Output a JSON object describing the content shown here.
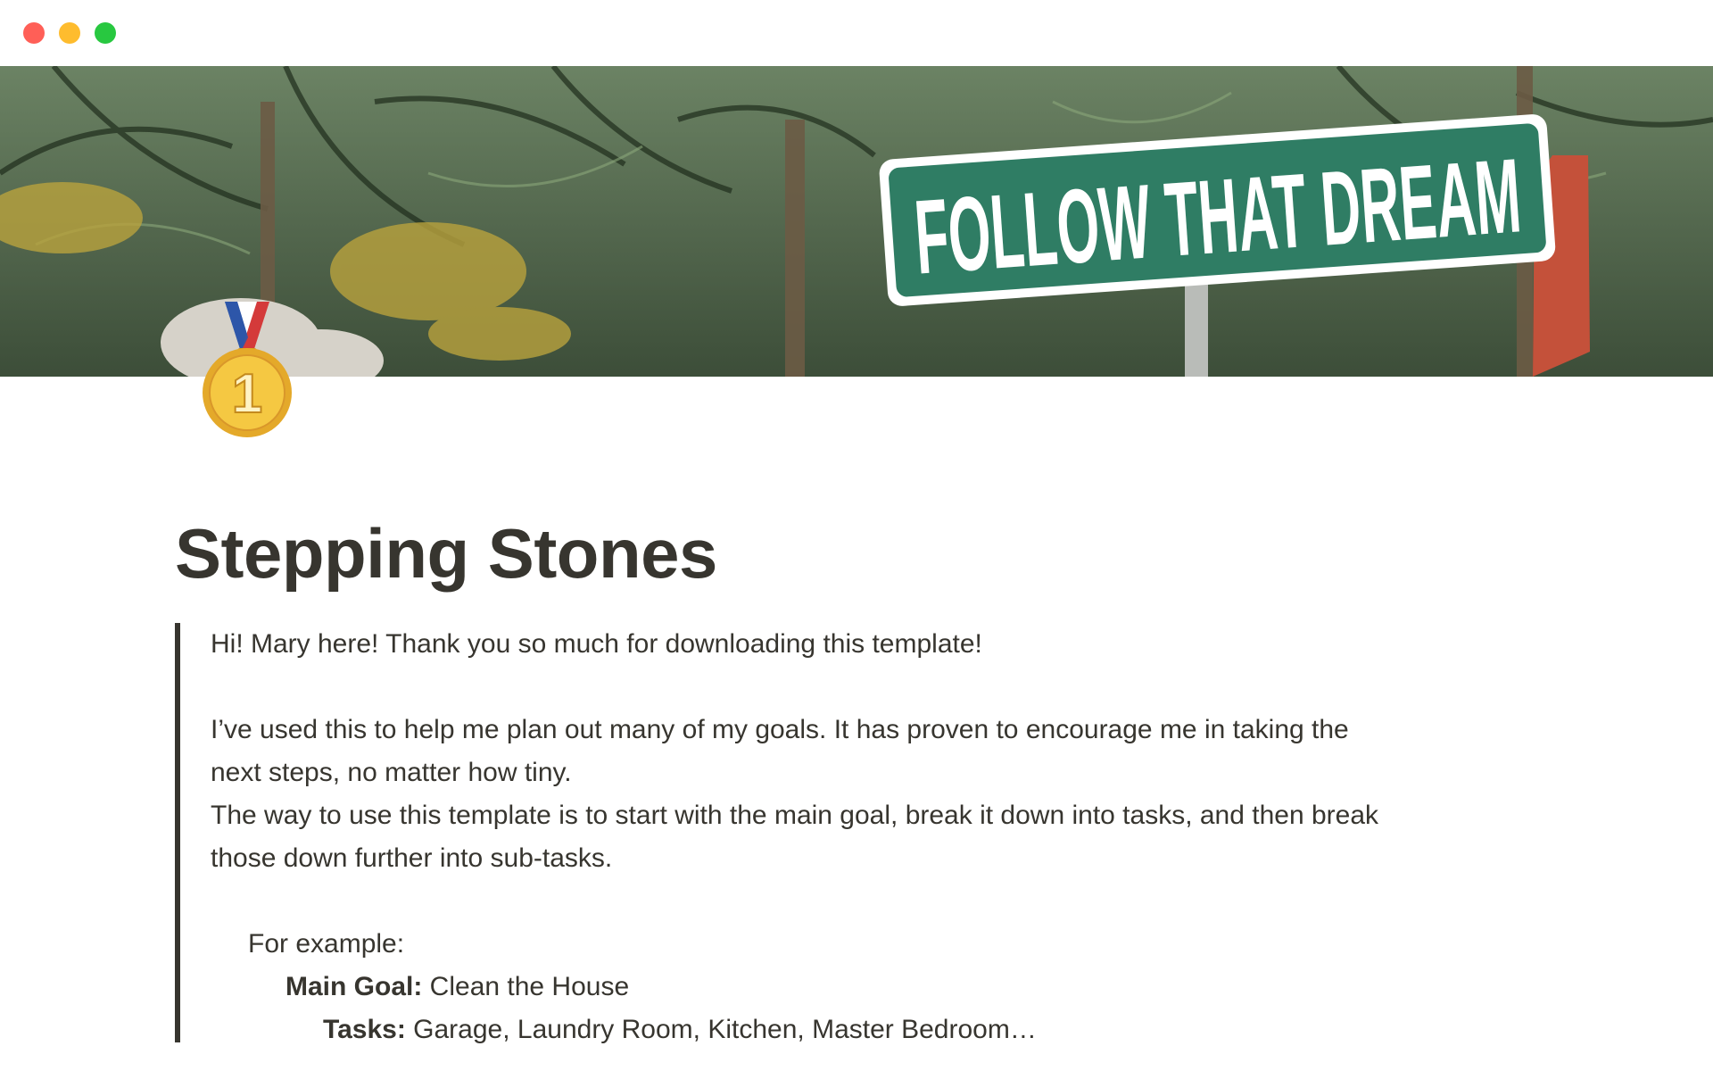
{
  "window": {
    "controls": [
      "close",
      "minimize",
      "maximize"
    ]
  },
  "cover": {
    "description_icon": "cover-image",
    "sign_text": "FOLLOW THAT DREAM"
  },
  "page": {
    "icon": "first-place-medal-icon",
    "medal_number": "1",
    "title": "Stepping Stones"
  },
  "quote": {
    "line1": "Hi! Mary here! Thank you so much for downloading this template!",
    "para2_line1": "I’ve used this to help me plan out many of my goals.  It has proven to encourage me in taking the",
    "para2_line2": "next steps, no matter how tiny.",
    "para3_line1": "The way to use this template is to start with the main goal, break it down into tasks, and then break",
    "para3_line2": "those down further into sub-tasks.",
    "example_label": "For example:",
    "main_goal_label": "Main Goal:",
    "main_goal_value": " Clean the House",
    "tasks_label": "Tasks:",
    "tasks_value": " Garage, Laundry Room, Kitchen, Master Bedroom…"
  },
  "colors": {
    "text": "#37352f",
    "close": "#ff5f57",
    "minimize": "#febc2e",
    "maximize": "#28c840",
    "sign_green": "#2f7d64"
  }
}
